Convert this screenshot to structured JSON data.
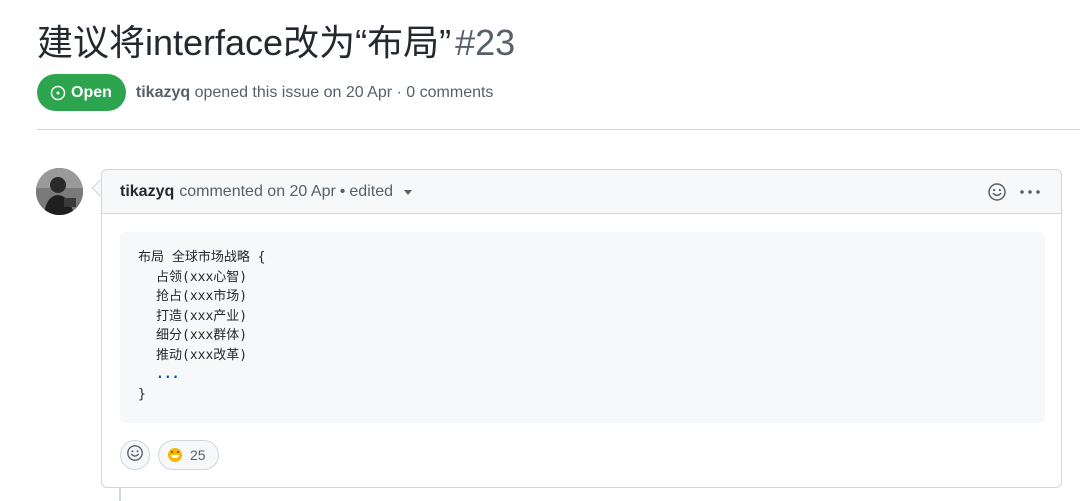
{
  "issue": {
    "title": "建议将interface改为“布局”",
    "number": "#23",
    "state": "Open",
    "author": "tikazyq",
    "opened_text": "opened this issue on 20 Apr · 0 comments"
  },
  "comment": {
    "author": "tikazyq",
    "commented_text": "commented on 20 Apr",
    "separator": "•",
    "edited_label": "edited",
    "code_lines": {
      "l0": "布局 全球市场战略 {",
      "l1": "占领(xxx心智)",
      "l2": "抢占(xxx市场)",
      "l3": "打造(xxx产业)",
      "l4": "细分(xxx群体)",
      "l5": "推动(xxx改革)",
      "l6": "...",
      "l7": "}"
    },
    "reaction": {
      "emoji": "grinning-face",
      "count": "25"
    }
  },
  "colors": {
    "open_green": "#2da44e",
    "border": "#d0d7de",
    "header_bg": "#f6f8fa",
    "muted_text": "#57606a"
  }
}
